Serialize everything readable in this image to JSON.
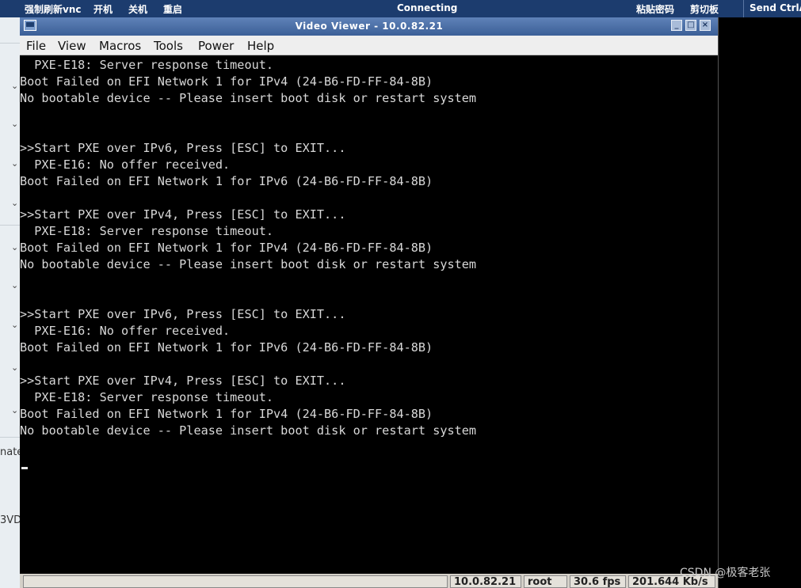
{
  "vnc_bar": {
    "refresh_label": "强制刷新vnc",
    "power_on_label": "开机",
    "power_off_label": "关机",
    "restart_label": "重启",
    "status": "Connecting",
    "paste_password_label": "粘贴密码",
    "clipboard_label": "剪切板",
    "send_ctrl_label": "Send CtrlA"
  },
  "left_strip": {
    "fragment_1": "nate",
    "fragment_2": "3VD"
  },
  "window": {
    "title": "Video Viewer - 10.0.82.21",
    "minimize": "_",
    "maximize": "□",
    "close": "×"
  },
  "menu": {
    "items": [
      "File",
      "View",
      "Macros",
      "Tools",
      "Power",
      "Help"
    ]
  },
  "console": {
    "lines": [
      "  PXE-E18: Server response timeout.",
      "Boot Failed on EFI Network 1 for IPv4 (24-B6-FD-FF-84-8B)",
      "No bootable device -- Please insert boot disk or restart system",
      "",
      "",
      ">>Start PXE over IPv6, Press [ESC] to EXIT...",
      "  PXE-E16: No offer received.",
      "Boot Failed on EFI Network 1 for IPv6 (24-B6-FD-FF-84-8B)",
      "",
      ">>Start PXE over IPv4, Press [ESC] to EXIT...",
      "  PXE-E18: Server response timeout.",
      "Boot Failed on EFI Network 1 for IPv4 (24-B6-FD-FF-84-8B)",
      "No bootable device -- Please insert boot disk or restart system",
      "",
      "",
      ">>Start PXE over IPv6, Press [ESC] to EXIT...",
      "  PXE-E16: No offer received.",
      "Boot Failed on EFI Network 1 for IPv6 (24-B6-FD-FF-84-8B)",
      "",
      ">>Start PXE over IPv4, Press [ESC] to EXIT...",
      "  PXE-E18: Server response timeout.",
      "Boot Failed on EFI Network 1 for IPv4 (24-B6-FD-FF-84-8B)",
      "No bootable device -- Please insert boot disk or restart system"
    ]
  },
  "status": {
    "ip": "10.0.82.21",
    "user": "root",
    "fps": "30.6 fps",
    "rate": "201.644 Kb/s"
  },
  "watermark": "CSDN @极客老张",
  "colors": {
    "vnc_bar": "#1c3c6e",
    "titlebar": "#3b5f97",
    "console_bg": "#000000",
    "console_text": "#d8d8d8"
  }
}
